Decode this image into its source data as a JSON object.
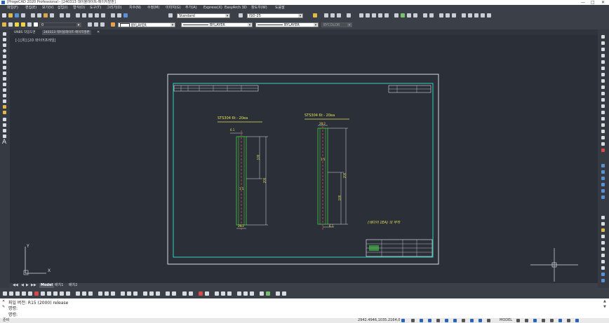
{
  "titlebar": {
    "title": "[ProgeCAD 2020 Professional - [240313 데이블레이트-메이지발판]",
    "controls": [
      "—",
      "□",
      "✕"
    ]
  },
  "menubar": {
    "items": [
      "파일(F)",
      "편집(E)",
      "보기(V)",
      "삽입(I)",
      "형식(O)",
      "도구(T)",
      "그리기(D)",
      "치수(N)",
      "수정(M)",
      "이미지(G)",
      "추가(A)",
      "Express(X)",
      "EasyArch 3D",
      "창도우(W)",
      "도움말"
    ]
  },
  "toolbar": {
    "textstyle": "Standard",
    "dimstyle": "ISO-25",
    "layer": "0",
    "color": "BYLAYER",
    "linetype": "BYLAYER",
    "lineweight": "BYLAYER",
    "plotstyle": "BYCOLOR"
  },
  "doctabs": [
    "UNBS 작업도면",
    "240313 테이블레이트-메이지발판"
  ],
  "viewport_label": "[-] [위] [2D 와이어프레임]",
  "drawing": {
    "left_title": "STS304 6t - 20ea",
    "right_title": "STS304 6t - 20ea",
    "left_dims": {
      "top_small": "6.1",
      "mid": "100",
      "long": "200",
      "inner": "1.5",
      "bottom": "26.2"
    },
    "right_dims": {
      "top_small": "26.2",
      "mid": "200",
      "long": "100",
      "inner": "1.5",
      "bottom": "6.1"
    },
    "note": "(네다이 1EA) 의 무작"
  },
  "ucs": {
    "x": "X",
    "y": "Y"
  },
  "layout_tabs": [
    "Model",
    "배치1",
    "배치2"
  ],
  "cmdline": {
    "line1": "파일 버전: R15 (2000) release",
    "line2": "명령:",
    "line3": "명령:"
  },
  "statusbar": {
    "left": "준비",
    "coords": "2942.4946,1035.2164,0",
    "model": "MODEL"
  }
}
